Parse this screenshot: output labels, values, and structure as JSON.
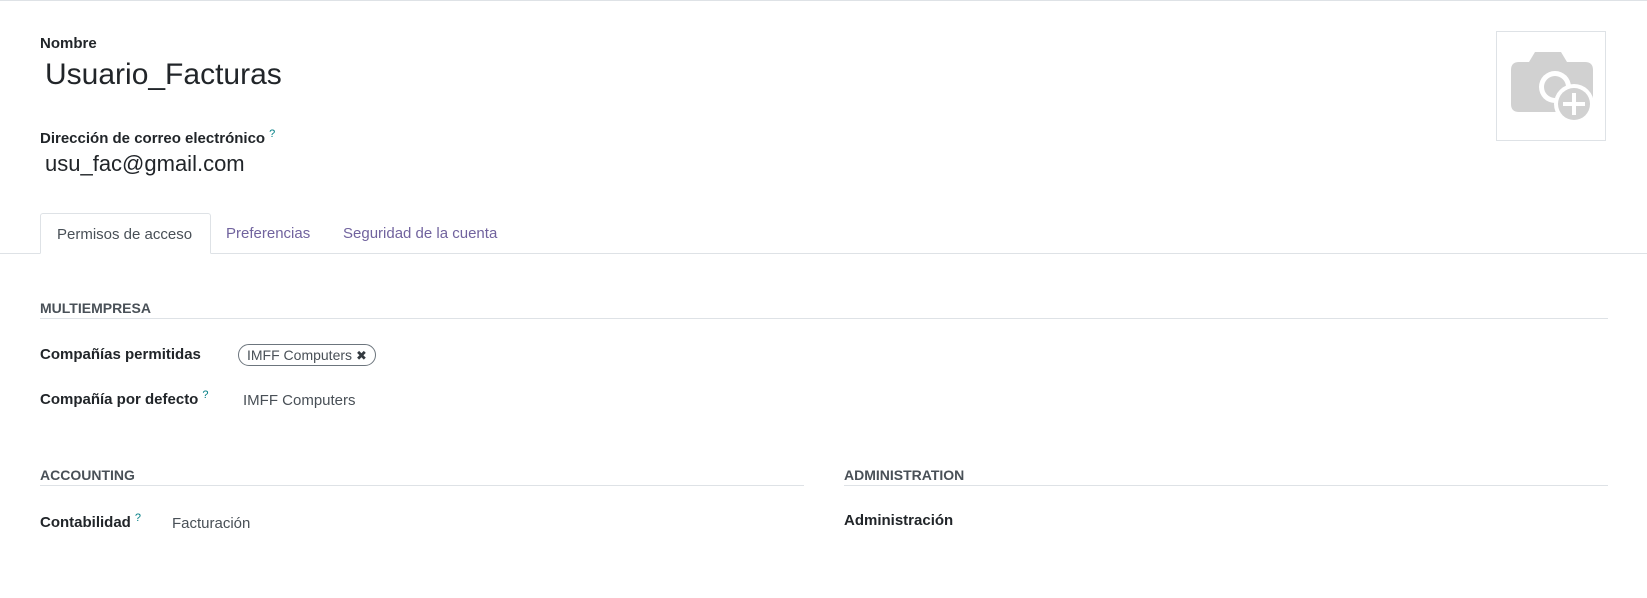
{
  "form": {
    "name_label": "Nombre",
    "name_value": "Usuario_Facturas",
    "email_label": "Dirección de correo electrónico",
    "email_help": "?",
    "email_value": "usu_fac@gmail.com",
    "avatar_icon": "camera-plus-icon"
  },
  "tabs": [
    {
      "label": "Permisos de acceso",
      "active": true
    },
    {
      "label": "Preferencias",
      "active": false
    },
    {
      "label": "Seguridad de la cuenta",
      "active": false
    }
  ],
  "multiempresa": {
    "title": "MULTIEMPRESA",
    "allowed_label": "Compañías permitidas",
    "allowed_tag": "IMFF Computers",
    "tag_remove_icon": "close-icon",
    "default_label": "Compañía por defecto",
    "default_help": "?",
    "default_value": "IMFF Computers"
  },
  "accounting": {
    "title": "ACCOUNTING",
    "field_label": "Contabilidad",
    "field_help": "?",
    "field_value": "Facturación"
  },
  "administration": {
    "title": "ADMINISTRATION",
    "field_label": "Administración"
  },
  "colors": {
    "tab_link": "#71639e",
    "help_mark": "#017e84",
    "border": "#dee2e6"
  }
}
